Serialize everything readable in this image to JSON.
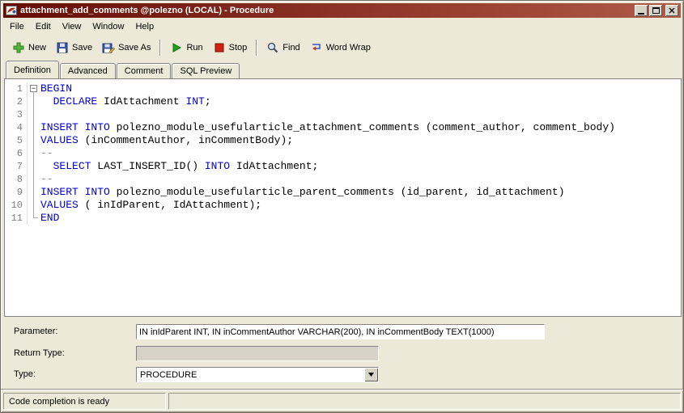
{
  "window": {
    "title": "attachment_add_comments @polezno (LOCAL) - Procedure"
  },
  "menu": {
    "items": [
      "File",
      "Edit",
      "View",
      "Window",
      "Help"
    ]
  },
  "toolbar": {
    "buttons": [
      {
        "label": "New",
        "icon": "new-icon"
      },
      {
        "label": "Save",
        "icon": "save-icon"
      },
      {
        "label": "Save As",
        "icon": "save-as-icon"
      },
      {
        "label": "Run",
        "icon": "run-icon"
      },
      {
        "label": "Stop",
        "icon": "stop-icon"
      },
      {
        "label": "Find",
        "icon": "find-icon"
      },
      {
        "label": "Word Wrap",
        "icon": "word-wrap-icon"
      }
    ]
  },
  "tabs": [
    {
      "label": "Definition",
      "active": true
    },
    {
      "label": "Advanced",
      "active": false
    },
    {
      "label": "Comment",
      "active": false
    },
    {
      "label": "SQL Preview",
      "active": false
    }
  ],
  "editor": {
    "lines": [
      {
        "n": "1",
        "tokens": [
          [
            "k",
            "BEGIN"
          ]
        ]
      },
      {
        "n": "2",
        "tokens": [
          [
            "p",
            "  "
          ],
          [
            "k",
            "DECLARE"
          ],
          [
            "p",
            " IdAttachment "
          ],
          [
            "k",
            "INT"
          ],
          [
            "p",
            ";"
          ]
        ]
      },
      {
        "n": "3",
        "tokens": []
      },
      {
        "n": "4",
        "tokens": [
          [
            "k",
            "INSERT"
          ],
          [
            "p",
            " "
          ],
          [
            "k",
            "INTO"
          ],
          [
            "p",
            " polezno_module_usefularticle_attachment_comments (comment_author, comment_body)"
          ]
        ]
      },
      {
        "n": "5",
        "tokens": [
          [
            "k",
            "VALUES"
          ],
          [
            "p",
            " (inCommentAuthor, inCommentBody);"
          ]
        ]
      },
      {
        "n": "6",
        "tokens": [
          [
            "c",
            "--"
          ]
        ]
      },
      {
        "n": "7",
        "tokens": [
          [
            "p",
            "  "
          ],
          [
            "k",
            "SELECT"
          ],
          [
            "p",
            " LAST_INSERT_ID() "
          ],
          [
            "k",
            "INTO"
          ],
          [
            "p",
            " IdAttachment;"
          ]
        ]
      },
      {
        "n": "8",
        "tokens": [
          [
            "c",
            "--"
          ]
        ]
      },
      {
        "n": "9",
        "tokens": [
          [
            "k",
            "INSERT"
          ],
          [
            "p",
            " "
          ],
          [
            "k",
            "INTO"
          ],
          [
            "p",
            " polezno_module_usefularticle_parent_comments (id_parent, id_attachment)"
          ]
        ]
      },
      {
        "n": "10",
        "tokens": [
          [
            "k",
            "VALUES"
          ],
          [
            "p",
            " ( inIdParent, IdAttachment);"
          ]
        ]
      },
      {
        "n": "11",
        "tokens": [
          [
            "k",
            "END"
          ]
        ]
      }
    ]
  },
  "form": {
    "parameter": {
      "label": "Parameter:",
      "value": "IN inIdParent INT, IN inCommentAuthor VARCHAR(200), IN inCommentBody TEXT(1000)"
    },
    "return_type": {
      "label": "Return Type:",
      "value": ""
    },
    "type": {
      "label": "Type:",
      "value": "PROCEDURE"
    }
  },
  "statusbar": {
    "left": "Code completion is ready",
    "right": ""
  },
  "colors": {
    "titlebar_gradient_start": "#650c05",
    "titlebar_gradient_end": "#b05a48",
    "panel_background": "#ece9d8",
    "keyword": "#0000cd",
    "comment_gray": "#909090",
    "line_number": "#808080",
    "run_green": "#1fa11f",
    "stop_red": "#cc2211"
  }
}
